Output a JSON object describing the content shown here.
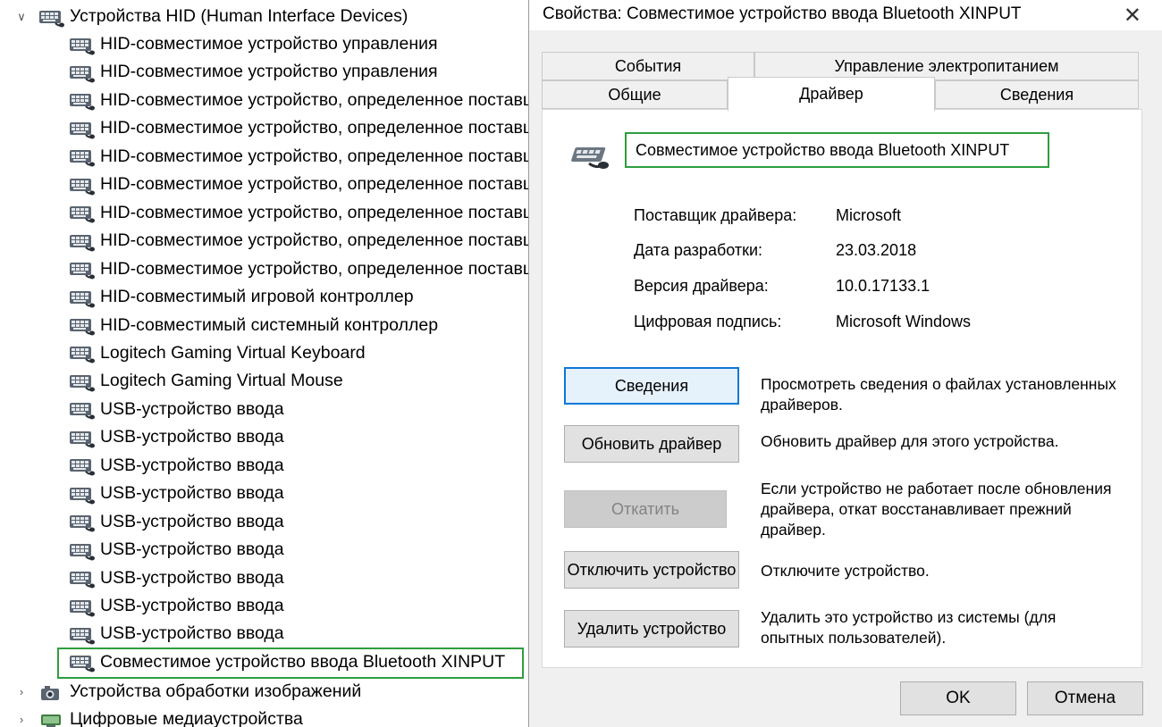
{
  "tree": {
    "category_hid": "Устройства HID (Human Interface Devices)",
    "items": [
      "HID-совместимое устройство управления",
      "HID-совместимое устройство управления",
      "HID-совместимое устройство, определенное поставщиком",
      "HID-совместимое устройство, определенное поставщиком",
      "HID-совместимое устройство, определенное поставщиком",
      "HID-совместимое устройство, определенное поставщиком",
      "HID-совместимое устройство, определенное поставщиком",
      "HID-совместимое устройство, определенное поставщиком",
      "HID-совместимое устройство, определенное поставщиком",
      "HID-совместимый игровой контроллер",
      "HID-совместимый системный контроллер",
      "Logitech Gaming Virtual Keyboard",
      "Logitech Gaming Virtual Mouse",
      "USB-устройство ввода",
      "USB-устройство ввода",
      "USB-устройство ввода",
      "USB-устройство ввода",
      "USB-устройство ввода",
      "USB-устройство ввода",
      "USB-устройство ввода",
      "USB-устройство ввода",
      "USB-устройство ввода",
      "Совместимое устройство ввода Bluetooth XINPUT"
    ],
    "category_imaging": "Устройства обработки изображений",
    "category_media": "Цифровые медиаустройства"
  },
  "dialog": {
    "title": "Свойства: Совместимое устройство ввода Bluetooth XINPUT",
    "tabs": {
      "events": "События",
      "power": "Управление электропитанием",
      "general": "Общие",
      "driver": "Драйвер",
      "details": "Сведения"
    },
    "device_name": "Совместимое устройство ввода Bluetooth XINPUT",
    "info": {
      "provider_label": "Поставщик драйвера:",
      "provider_value": "Microsoft",
      "date_label": "Дата разработки:",
      "date_value": "23.03.2018",
      "version_label": "Версия драйвера:",
      "version_value": "10.0.17133.1",
      "signature_label": "Цифровая подпись:",
      "signature_value": "Microsoft Windows"
    },
    "buttons": {
      "details_label": "Сведения",
      "details_desc": "Просмотреть сведения о файлах установленных драйверов.",
      "update_label": "Обновить драйвер",
      "update_desc": "Обновить драйвер для этого устройства.",
      "rollback_label": "Откатить",
      "rollback_desc": "Если устройство не работает после обновления драйвера, откат восстанавливает прежний драйвер.",
      "disable_label": "Отключить устройство",
      "disable_desc": "Отключите устройство.",
      "uninstall_label": "Удалить устройство",
      "uninstall_desc": "Удалить это устройство из системы (для опытных пользователей)."
    },
    "footer": {
      "ok": "OK",
      "cancel": "Отмена"
    }
  },
  "colors": {
    "highlight": "#2e9e3e",
    "focus": "#0a78d7",
    "dialog_bg": "#f0f0f0"
  }
}
